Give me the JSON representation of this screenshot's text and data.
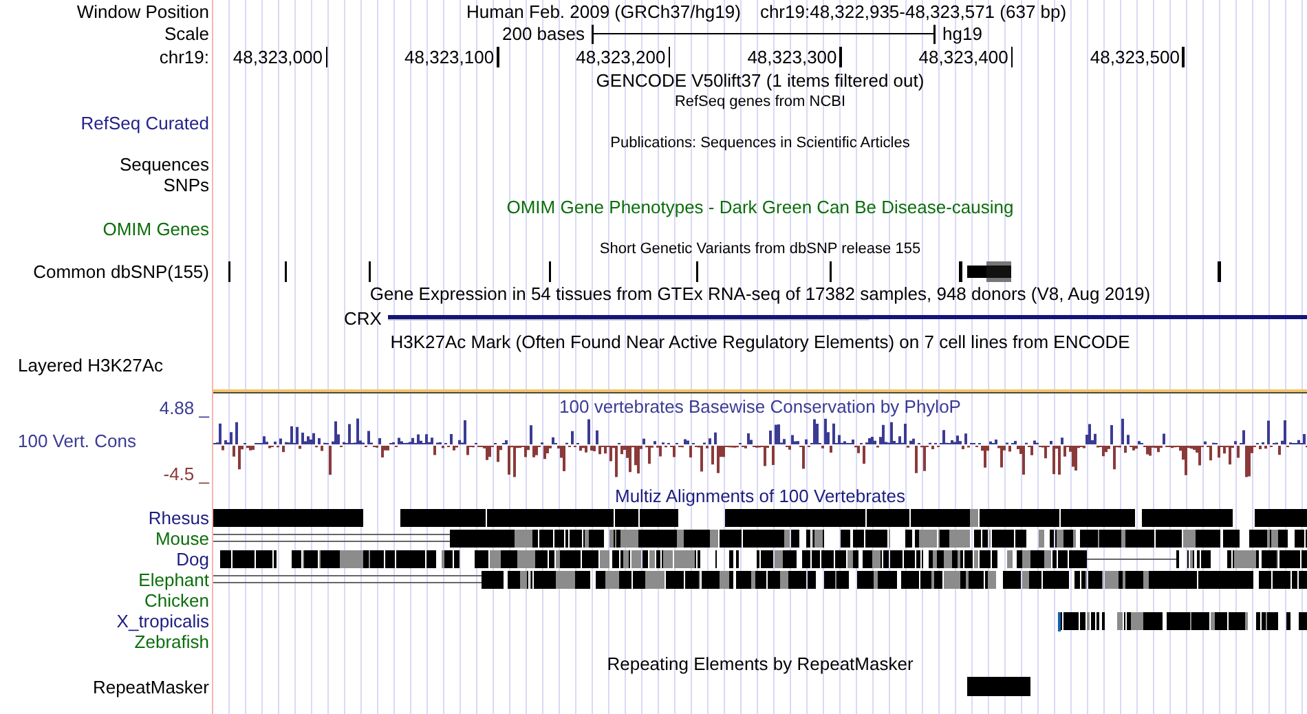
{
  "header": {
    "label": "Window Position",
    "assembly": "Human Feb. 2009 (GRCh37/hg19)",
    "position": "chr19:48,322,935-48,323,571 (637 bp)"
  },
  "scale": {
    "label": "Scale",
    "length": "200 bases",
    "assembly": "hg19"
  },
  "ruler": {
    "label": "chr19:",
    "ticks": [
      "48,323,000",
      "48,323,100",
      "48,323,200",
      "48,323,300",
      "48,323,400",
      "48,323,500"
    ]
  },
  "tracks": [
    {
      "kind": "caption",
      "title": "GENCODE V50lift37 (1 items filtered out)"
    },
    {
      "kind": "note",
      "title": "RefSeq genes from NCBI"
    },
    {
      "kind": "label",
      "label": "RefSeq Curated",
      "color": "#23238c"
    },
    {
      "kind": "note",
      "title": "Publications: Sequences in Scientific Articles"
    },
    {
      "kind": "label",
      "label": "Sequences",
      "color": "#000000"
    },
    {
      "kind": "label",
      "label": "SNPs",
      "color": "#000000"
    },
    {
      "kind": "caption",
      "title": "OMIM Gene Phenotypes - Dark Green Can Be Disease-causing",
      "color": "#0b6e0b"
    },
    {
      "kind": "label",
      "label": "OMIM Genes",
      "color": "#0b6e0b"
    },
    {
      "kind": "note",
      "title": "Short Genetic Variants from dbSNP release 155"
    },
    {
      "kind": "snps",
      "label": "Common dbSNP(155)"
    },
    {
      "kind": "caption",
      "title": "Gene Expression in 54 tissues from GTEx RNA-seq of 17382 samples, 948 donors (V8, Aug 2019)"
    },
    {
      "kind": "gene",
      "gene": "CRX"
    },
    {
      "kind": "caption",
      "title": "H3K27Ac Mark (Often Found Near Active Regulatory Elements) on 7 cell lines from ENCODE"
    },
    {
      "kind": "group",
      "label": "Layered H3K27Ac"
    },
    {
      "kind": "density"
    },
    {
      "kind": "wiggle",
      "title": "100 vertebrates Basewise Conservation by PhyloP",
      "label": "100 Vert. Cons",
      "max": "4.88 _",
      "min": "-4.5 _"
    },
    {
      "kind": "caption",
      "title": "Multiz Alignments of 100 Vertebrates",
      "color": "#1c1c80"
    },
    {
      "kind": "species",
      "label": "Rhesus",
      "color": "#1c1c80"
    },
    {
      "kind": "species",
      "label": "Mouse",
      "color": "#0b6e0b"
    },
    {
      "kind": "species",
      "label": "Dog",
      "color": "#1c1c80"
    },
    {
      "kind": "species",
      "label": "Elephant",
      "color": "#0b6e0b"
    },
    {
      "kind": "species",
      "label": "Chicken",
      "color": "#0b6e0b"
    },
    {
      "kind": "species",
      "label": "X_tropicalis",
      "color": "#1c1c80"
    },
    {
      "kind": "species",
      "label": "Zebrafish",
      "color": "#0b6e0b"
    },
    {
      "kind": "caption",
      "title": "Repeating Elements by RepeatMasker"
    },
    {
      "kind": "repeat",
      "label": "RepeatMasker"
    }
  ]
}
